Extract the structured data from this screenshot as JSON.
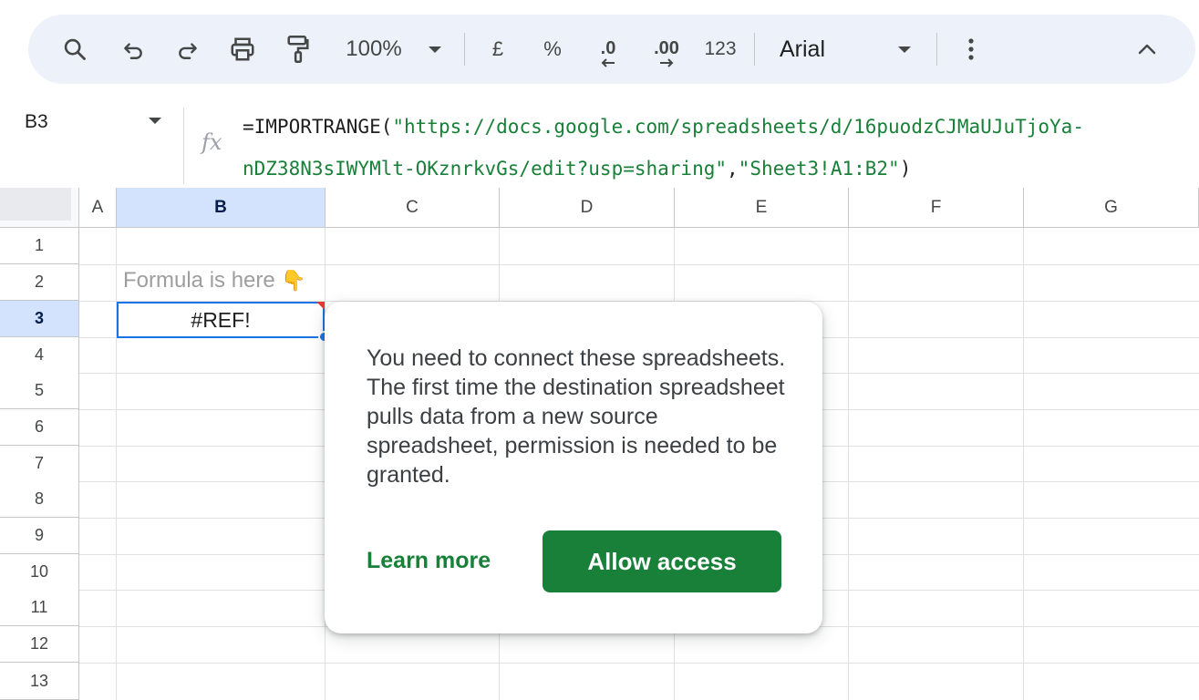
{
  "toolbar": {
    "zoom": "100%",
    "currency": "£",
    "percent": "%",
    "decrease_decimal": ".0",
    "increase_decimal": ".00",
    "number_format": "123",
    "font": "Arial",
    "icons": [
      "search-icon",
      "undo-icon",
      "redo-icon",
      "print-icon",
      "paint-format-icon",
      "zoom-dropdown-icon",
      "more-vert-icon",
      "collapse-icon"
    ]
  },
  "formula_bar": {
    "name_box": "B3",
    "fx": "fx",
    "formula_prefix": "=IMPORTRANGE(",
    "formula_url": "\"https://docs.google.com/spreadsheets/d/16puodzCJMaUJuTjoYa-nDZ38N3sIWYMlt-OKznrkvGs/edit?usp=sharing\"",
    "formula_comma": ",",
    "formula_range": "\"Sheet3!A1:B2\"",
    "formula_suffix": ")"
  },
  "grid": {
    "columns": [
      "A",
      "B",
      "C",
      "D",
      "E",
      "F",
      "G"
    ],
    "rows": [
      "1",
      "2",
      "3",
      "4",
      "5",
      "6",
      "7",
      "8",
      "9",
      "10",
      "11",
      "12",
      "13"
    ],
    "selected_column": "B",
    "selected_row": "3",
    "b2_text": "Formula is here",
    "b2_emoji": "👇",
    "b3_value": "#REF!"
  },
  "popup": {
    "message": "You need to connect these spreadsheets. The first time the destination spreadsheet pulls data from a new source spreadsheet, permission is needed to be granted.",
    "learn_more": "Learn more",
    "allow_access": "Allow access"
  },
  "colors": {
    "toolbar_bg": "#edf2fa",
    "selected_header": "#d3e3fd",
    "selection_border": "#1a73e8",
    "accent_green": "#188038"
  }
}
